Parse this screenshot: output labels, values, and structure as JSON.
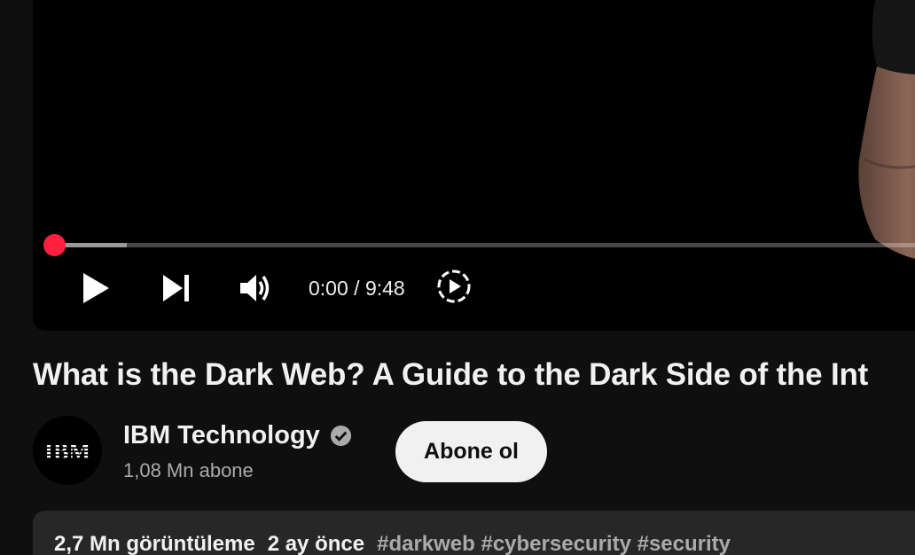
{
  "player": {
    "current_time": "0:00",
    "separator": " / ",
    "duration": "9:48",
    "progress_fraction": 0,
    "buffered_fraction": 0.08,
    "progress_color": "#ff0033"
  },
  "video": {
    "title": "What is the Dark Web? A Guide to the Dark Side of the Int"
  },
  "channel": {
    "name": "IBM Technology",
    "subscribers": "1,08 Mn abone",
    "avatar_logo": "IBM",
    "verified_icon": "verified-check-icon"
  },
  "subscribe": {
    "label": "Abone ol"
  },
  "description": {
    "views": "2,7 Mn görüntüleme",
    "age": "2 ay önce",
    "hashtags": "#darkweb #cybersecurity #security"
  },
  "icons": {
    "play": "play-icon",
    "next": "next-icon",
    "volume": "volume-icon",
    "autoplay": "autoplay-icon"
  }
}
